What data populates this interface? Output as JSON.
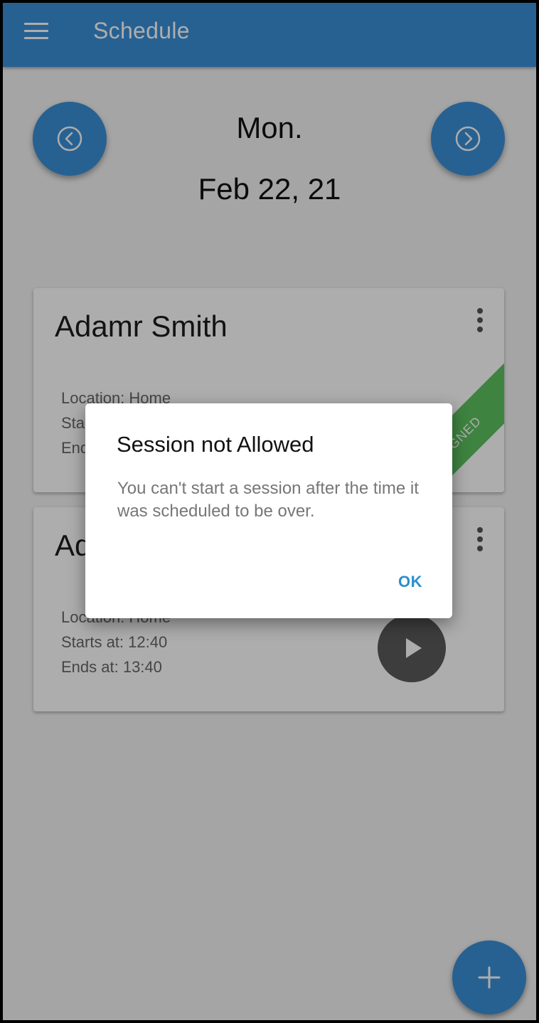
{
  "app_bar": {
    "title": "Schedule"
  },
  "date_nav": {
    "day": "Mon.",
    "date": "Feb 22, 21"
  },
  "sessions": [
    {
      "name": "Adamr Smith",
      "location": "Location: Home",
      "starts_partial": "Sta",
      "ends_partial": "End",
      "badge": "SIGNED"
    },
    {
      "name_partial": "Ad",
      "location": "Location: Home",
      "starts": "Starts at: 12:40",
      "ends": "Ends at: 13:40"
    }
  ],
  "dialog": {
    "title": "Session not Allowed",
    "message": "You can't start a session after the time it was scheduled to be over.",
    "ok_label": "OK"
  },
  "colors": {
    "primary": "#3a8fd8",
    "signed": "#5cc25f",
    "play": "#5a5a5a"
  }
}
